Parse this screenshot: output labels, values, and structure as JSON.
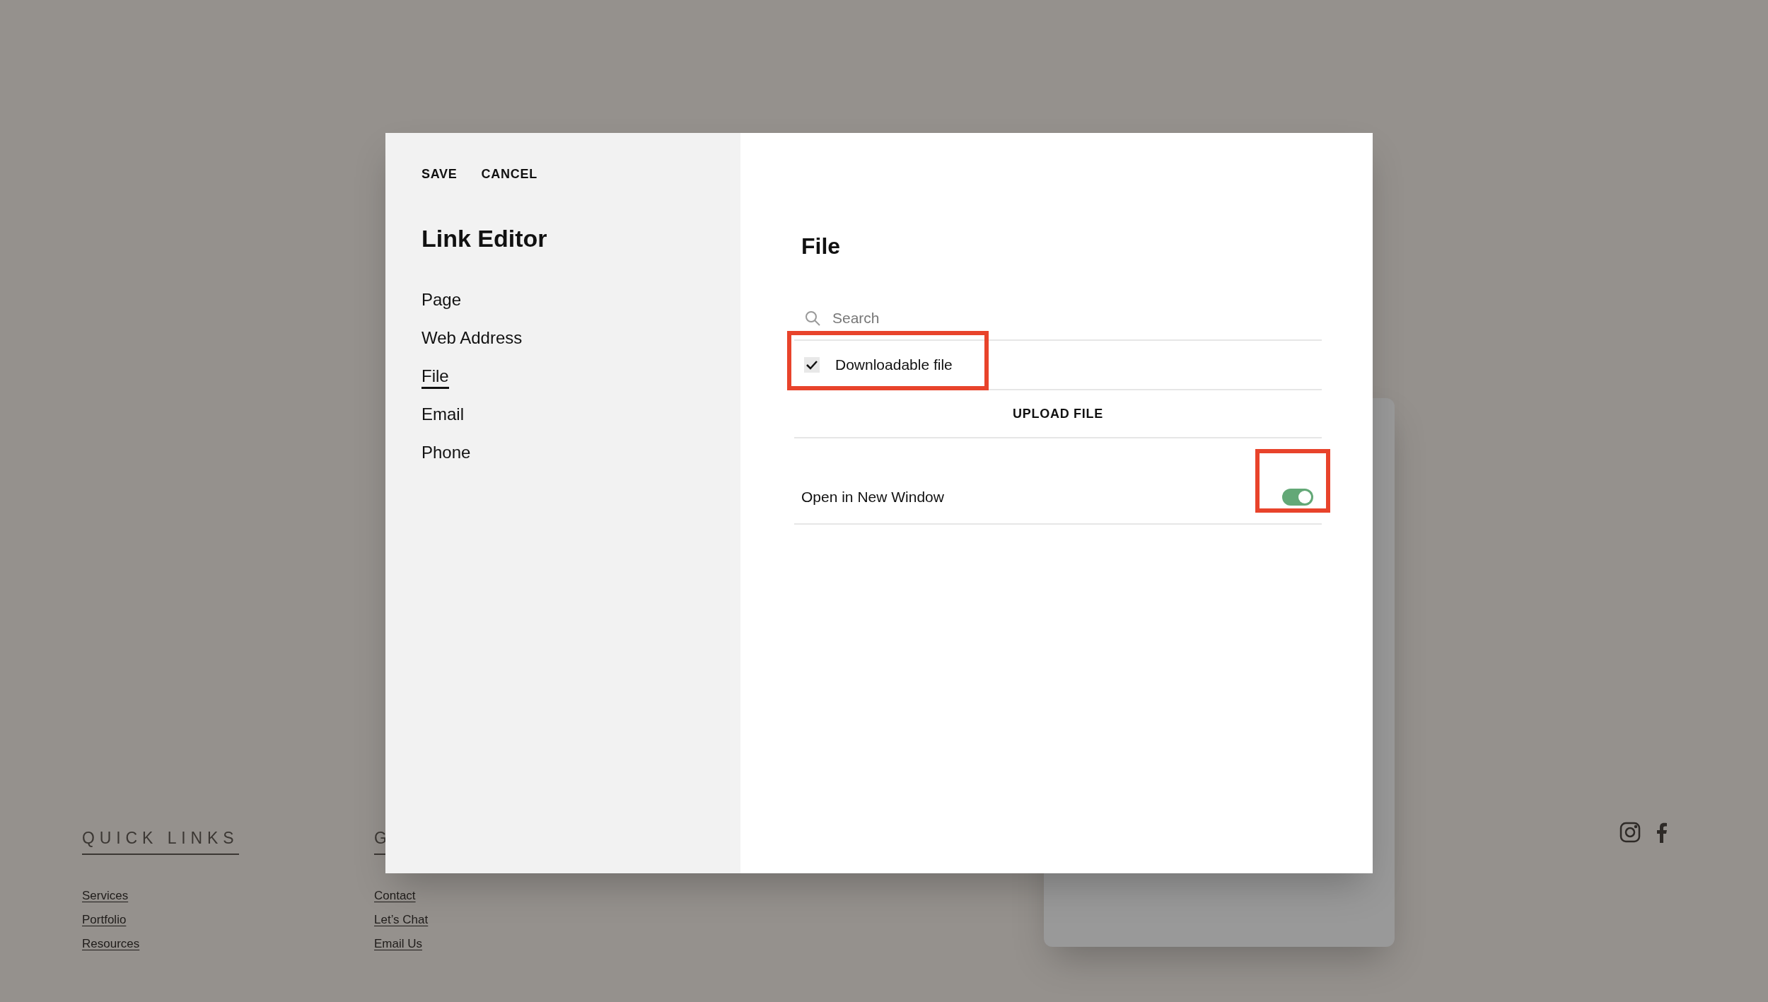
{
  "footer": {
    "columns": [
      {
        "heading": "QUICK LINKS",
        "links": [
          "Services",
          "Portfolio",
          "Resources"
        ]
      },
      {
        "heading": "G",
        "links": [
          "Contact",
          "Let’s Chat",
          "Email Us"
        ]
      }
    ]
  },
  "dialog": {
    "actions": [
      "SAVE",
      "CANCEL"
    ],
    "title": "Link Editor",
    "nav": [
      {
        "label": "Page",
        "selected": false
      },
      {
        "label": "Web Address",
        "selected": false
      },
      {
        "label": "File",
        "selected": true
      },
      {
        "label": "Email",
        "selected": false
      },
      {
        "label": "Phone",
        "selected": false
      }
    ],
    "panel": {
      "title": "File",
      "search": {
        "placeholder": "Search"
      },
      "downloadable": {
        "label": "Downloadable file",
        "checked": true,
        "highlighted": true
      },
      "upload_button": "UPLOAD FILE",
      "open_in_new_window": {
        "label": "Open in New Window",
        "on": true,
        "highlighted": true
      }
    }
  }
}
